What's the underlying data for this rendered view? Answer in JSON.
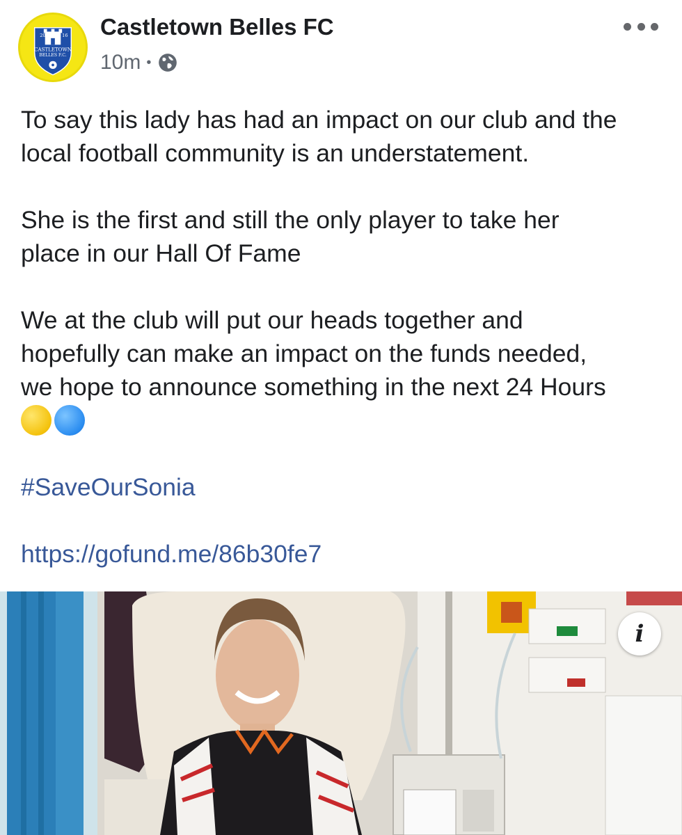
{
  "post": {
    "page_name": "Castletown Belles FC",
    "timestamp": "10m",
    "separator": "•",
    "audience_icon": "globe-icon",
    "more_icon": "more-options-icon",
    "avatar": {
      "year_left": "20",
      "year_right": "16",
      "line1": "CASTLETOWN",
      "line2": "BELLES F.C."
    },
    "paragraphs": [
      [
        "To say this lady has had an impact on our club and the",
        "local football community is an understatement."
      ],
      [
        "She is the first and still the only player to take her",
        "place in our Hall Of Fame"
      ],
      [
        "We at the club will put our heads together and",
        "hopefully can make an impact on the funds needed,",
        "we hope to announce something in the next 24 Hours"
      ]
    ],
    "emojis": [
      "yellow-circle-emoji",
      "blue-circle-emoji"
    ],
    "hashtag": "#SaveOurSonia",
    "link": "https://gofund.me/86b30fe7",
    "info_button_label": "i"
  },
  "colors": {
    "text": "#1c1e21",
    "meta": "#606770",
    "link": "#385898",
    "badge_yellow": "#f5e614",
    "badge_blue": "#1f4fa8"
  }
}
